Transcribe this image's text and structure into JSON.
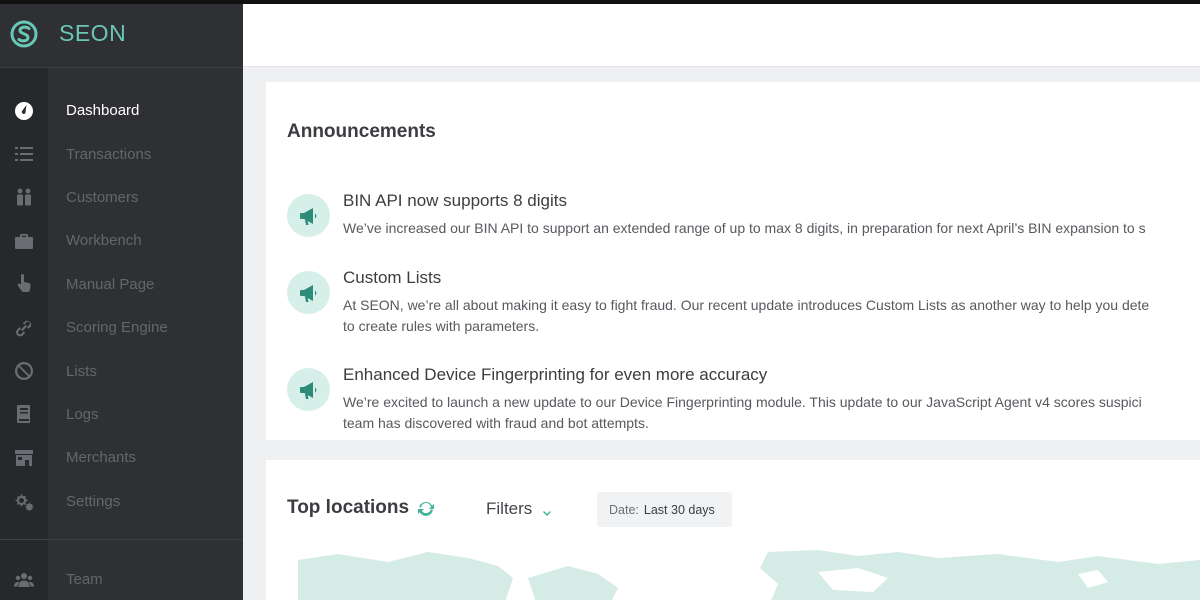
{
  "brand": {
    "name": "SEON",
    "accent": "#69c7b6"
  },
  "sidebar": {
    "items": [
      {
        "label": "Dashboard",
        "icon": "dashboard-gauge-icon",
        "active": true
      },
      {
        "label": "Transactions",
        "icon": "list-icon"
      },
      {
        "label": "Customers",
        "icon": "customers-icon"
      },
      {
        "label": "Workbench",
        "icon": "briefcase-icon"
      },
      {
        "label": "Manual Page",
        "icon": "pointer-hand-icon"
      },
      {
        "label": "Scoring Engine",
        "icon": "link-icon"
      },
      {
        "label": "Lists",
        "icon": "block-icon"
      },
      {
        "label": "Logs",
        "icon": "book-icon"
      },
      {
        "label": "Merchants",
        "icon": "store-icon"
      },
      {
        "label": "Settings",
        "icon": "gears-icon"
      }
    ],
    "team": {
      "label": "Team",
      "icon": "team-icon"
    }
  },
  "announcements": {
    "title": "Announcements",
    "items": [
      {
        "title": "BIN API now supports 8 digits",
        "body": [
          "We’ve increased our BIN API to support an extended range of up to max 8 digits, in preparation for next April’s BIN expansion to s"
        ]
      },
      {
        "title": "Custom Lists",
        "body": [
          "At SEON, we’re all about making it easy to fight fraud. Our recent update introduces Custom Lists as another way to help you dete",
          "to create rules with parameters."
        ]
      },
      {
        "title": "Enhanced Device Fingerprinting for even more accuracy",
        "body": [
          "We’re excited to launch a new update to our Device Fingerprinting module. This update to our JavaScript Agent v4 scores suspici",
          "team has discovered with fraud and bot attempts."
        ]
      }
    ]
  },
  "locations": {
    "title": "Top locations",
    "filters_label": "Filters",
    "date_label": "Date:",
    "date_value": "Last 30 days",
    "map_color": "#d5ece6"
  }
}
